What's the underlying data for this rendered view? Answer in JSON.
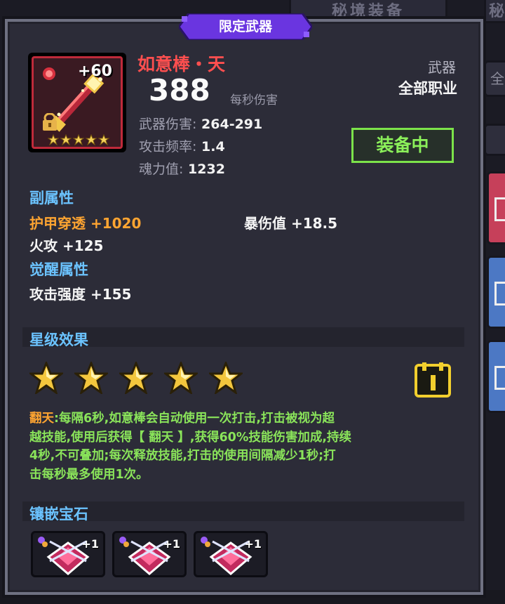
{
  "background": {
    "top_tab": "秘境装备",
    "top_tab2": "秘",
    "side_label": "全"
  },
  "badge": {
    "label": "限定武器"
  },
  "item": {
    "name": "如意棒・天",
    "level": "+60",
    "dps": "388",
    "dps_label": "每秒伤害",
    "stats": [
      {
        "label": "武器伤害:",
        "value": "264-291"
      },
      {
        "label": "攻击频率:",
        "value": "1.4"
      },
      {
        "label": "魂力值:",
        "value": "1232"
      }
    ],
    "type": "武器",
    "class": "全部职业",
    "equipped_label": "装备中",
    "mini_stars": 5
  },
  "secondary": {
    "title": "副属性",
    "attrs": [
      {
        "text": "护甲穿透 +1020"
      },
      {
        "text": "暴伤值 +18.5"
      },
      {
        "text": "火攻 +125"
      }
    ]
  },
  "awaken": {
    "title": "觉醒属性",
    "attrs": [
      {
        "text": "攻击强度 +155"
      }
    ]
  },
  "star_effect": {
    "title": "星级效果",
    "stars": 5,
    "skill_name": "翻天",
    "description_1": ":每隔6秒,如意棒会自动使用一次打击,打击被视为超",
    "description_2": "越技能,使用后获得【 翻天 】,获得60%技能伤害加成,持续",
    "description_3": "4秒,不可叠加;每次释放技能,打击的使用间隔减少1秒;打",
    "description_4": "击每秒最多使用1次。"
  },
  "gems": {
    "title": "镶嵌宝石",
    "slots": [
      {
        "plus": "+1"
      },
      {
        "plus": "+1"
      },
      {
        "plus": "+1"
      }
    ]
  },
  "colors": {
    "name_red": "#ff4f4f",
    "section_blue": "#6bc3ff",
    "effect_green": "#8ae45a",
    "highlight_orange": "#ffa531",
    "badge_purple": "#6a35e0"
  }
}
